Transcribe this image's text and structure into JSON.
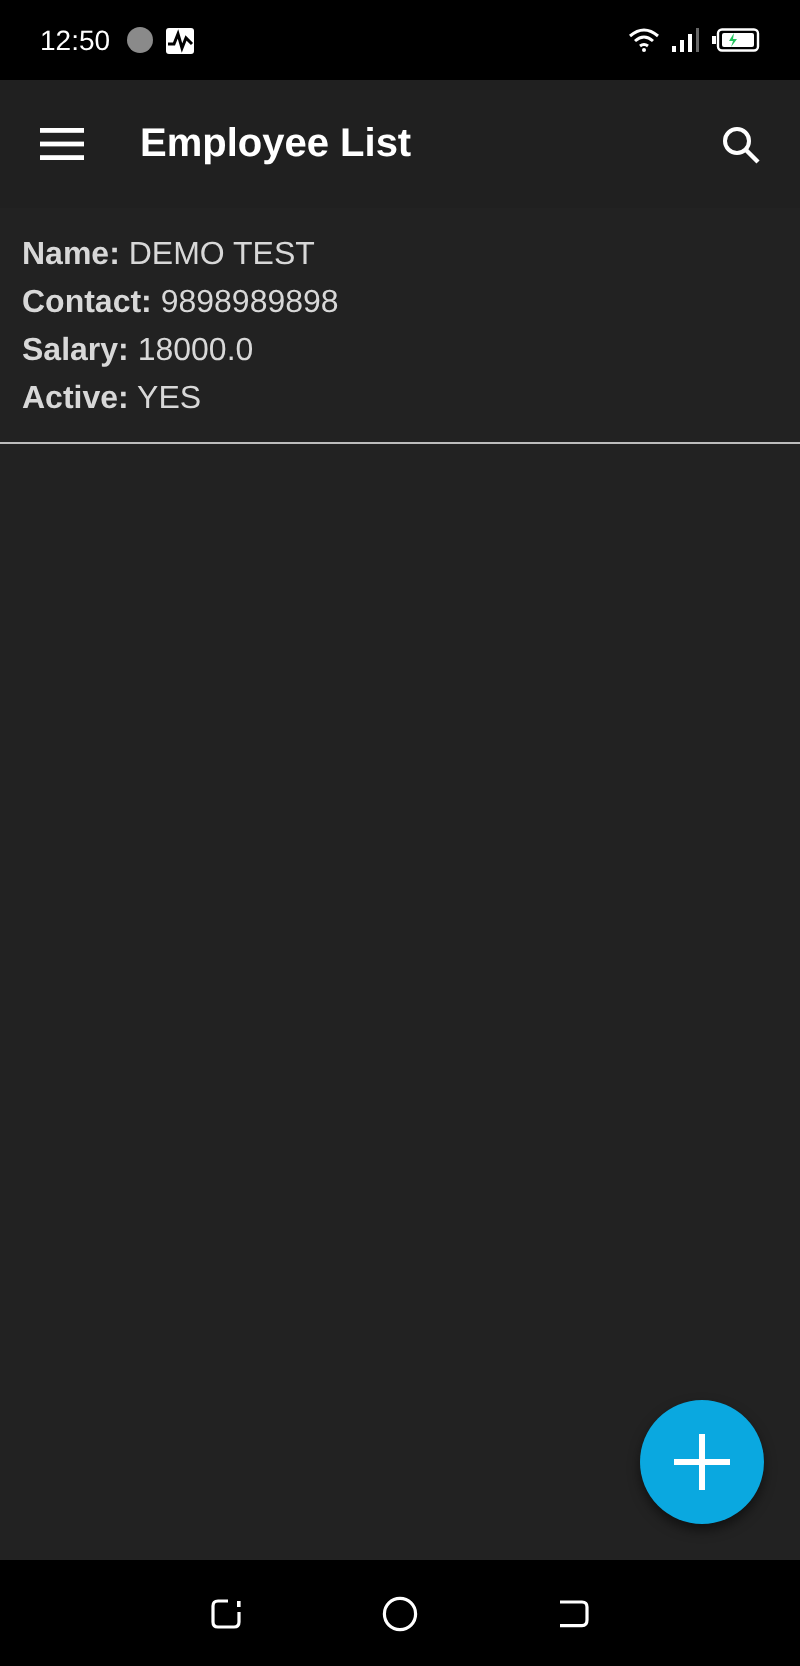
{
  "status_bar": {
    "time": "12:50"
  },
  "app_bar": {
    "title": "Employee List"
  },
  "employees": [
    {
      "lines": [
        "**Name:** DEMO TEST",
        "**Contact:** 9898989898",
        "**Salary:** 18000.0",
        "**Active:** YES"
      ]
    }
  ]
}
